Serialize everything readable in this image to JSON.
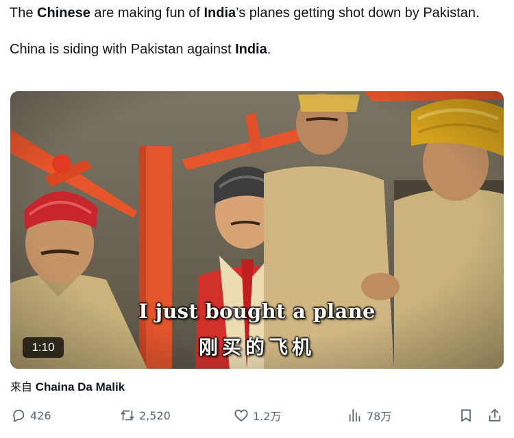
{
  "tweet": {
    "paragraph1": [
      {
        "t": "The ",
        "b": false
      },
      {
        "t": "Chinese",
        "b": true
      },
      {
        "t": " are making fun of ",
        "b": false
      },
      {
        "t": "India",
        "b": true
      },
      {
        "t": "’s planes getting shot down by Pakistan.",
        "b": false
      }
    ],
    "paragraph2": [
      {
        "t": "China is siding with Pakistan against ",
        "b": false
      },
      {
        "t": "India",
        "b": true
      },
      {
        "t": ".",
        "b": false
      }
    ]
  },
  "video": {
    "subtitle_en": "I just bought a plane",
    "subtitle_zh": "刚买的飞机",
    "duration": "1:10"
  },
  "source": {
    "prefix": "来自",
    "author": "Chaina Da Malik"
  },
  "actions": {
    "replies": "426",
    "retweets": "2,520",
    "likes": "1.2万",
    "views": "78万"
  },
  "colors": {
    "text": "#0f1419",
    "secondary": "#536471",
    "plane_orange": "#e8552b",
    "turban_red": "#c8262e",
    "turban_gold": "#d4a11c",
    "uniform_khaki": "#c9b27c"
  }
}
